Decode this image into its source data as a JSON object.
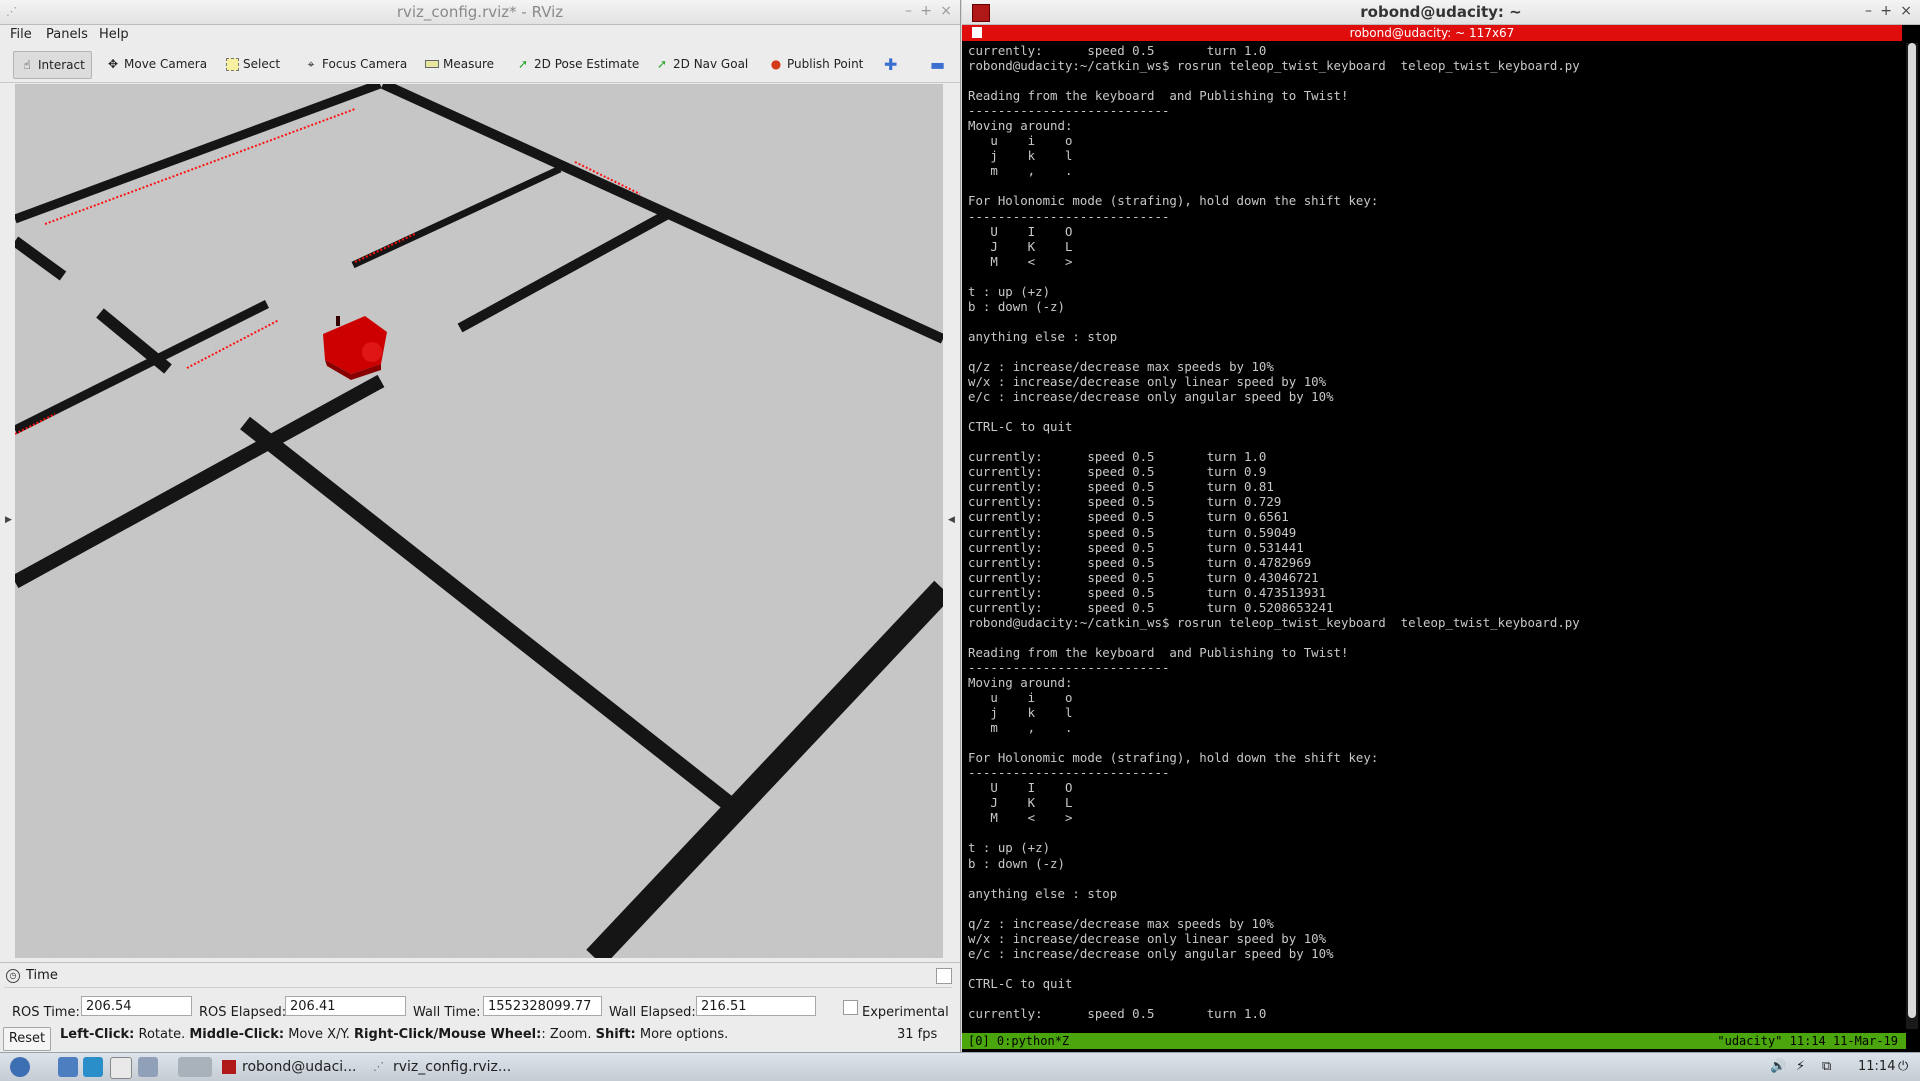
{
  "rviz": {
    "title": "rviz_config.rviz* - RViz",
    "window_buttons": [
      "–",
      "+",
      "×"
    ],
    "menu": [
      "File",
      "Panels",
      "Help"
    ],
    "tools": [
      {
        "label": "Interact",
        "icon": "hand-icon"
      },
      {
        "label": "Move Camera",
        "icon": "move-icon"
      },
      {
        "label": "Select",
        "icon": "select-icon"
      },
      {
        "label": "Focus Camera",
        "icon": "focus-icon"
      },
      {
        "label": "Measure",
        "icon": "ruler-icon"
      },
      {
        "label": "2D Pose Estimate",
        "icon": "pose-arrow-icon"
      },
      {
        "label": "2D Nav Goal",
        "icon": "goal-arrow-icon"
      },
      {
        "label": "Publish Point",
        "icon": "pin-icon"
      }
    ],
    "time_panel": {
      "title": "Time",
      "ros_time_label": "ROS Time:",
      "ros_time": "206.54",
      "ros_elapsed_label": "ROS Elapsed:",
      "ros_elapsed": "206.41",
      "wall_time_label": "Wall Time:",
      "wall_time": "1552328099.77",
      "wall_elapsed_label": "Wall Elapsed:",
      "wall_elapsed": "216.51",
      "experimental_label": "Experimental"
    },
    "status": {
      "reset": "Reset",
      "left_click": "Left-Click:",
      "left_click_desc": "Rotate.",
      "middle_click": "Middle-Click:",
      "middle_click_desc": "Move X/Y.",
      "right_click": "Right-Click/Mouse Wheel:",
      "right_click_desc": ": Zoom.",
      "shift": "Shift:",
      "shift_desc": "More options.",
      "fps": "31 fps"
    },
    "colors": {
      "floor": "#c6c6c6",
      "wall": "#151515",
      "robot": "#cc0000",
      "laser": "#ff1010"
    }
  },
  "terminal": {
    "title": "robond@udacity: ~",
    "tab_title": "robond@udacity: ~ 117x67",
    "lines": [
      "currently:      speed 0.5       turn 1.0",
      "robond@udacity:~/catkin_ws$ rosrun teleop_twist_keyboard  teleop_twist_keyboard.py",
      "",
      "Reading from the keyboard  and Publishing to Twist!",
      "---------------------------",
      "Moving around:",
      "   u    i    o",
      "   j    k    l",
      "   m    ,    .",
      "",
      "For Holonomic mode (strafing), hold down the shift key:",
      "---------------------------",
      "   U    I    O",
      "   J    K    L",
      "   M    <    >",
      "",
      "t : up (+z)",
      "b : down (-z)",
      "",
      "anything else : stop",
      "",
      "q/z : increase/decrease max speeds by 10%",
      "w/x : increase/decrease only linear speed by 10%",
      "e/c : increase/decrease only angular speed by 10%",
      "",
      "CTRL-C to quit",
      "",
      "currently:      speed 0.5       turn 1.0",
      "currently:      speed 0.5       turn 0.9",
      "currently:      speed 0.5       turn 0.81",
      "currently:      speed 0.5       turn 0.729",
      "currently:      speed 0.5       turn 0.6561",
      "currently:      speed 0.5       turn 0.59049",
      "currently:      speed 0.5       turn 0.531441",
      "currently:      speed 0.5       turn 0.4782969",
      "currently:      speed 0.5       turn 0.43046721",
      "currently:      speed 0.5       turn 0.473513931",
      "currently:      speed 0.5       turn 0.5208653241",
      "robond@udacity:~/catkin_ws$ rosrun teleop_twist_keyboard  teleop_twist_keyboard.py",
      "",
      "Reading from the keyboard  and Publishing to Twist!",
      "---------------------------",
      "Moving around:",
      "   u    i    o",
      "   j    k    l",
      "   m    ,    .",
      "",
      "For Holonomic mode (strafing), hold down the shift key:",
      "---------------------------",
      "   U    I    O",
      "   J    K    L",
      "   M    <    >",
      "",
      "t : up (+z)",
      "b : down (-z)",
      "",
      "anything else : stop",
      "",
      "q/z : increase/decrease max speeds by 10%",
      "w/x : increase/decrease only linear speed by 10%",
      "e/c : increase/decrease only angular speed by 10%",
      "",
      "CTRL-C to quit",
      "",
      "currently:      speed 0.5       turn 1.0"
    ],
    "status_left": "[0] 0:python*Z",
    "status_right": "\"udacity\" 11:14 11-Mar-19"
  },
  "taskbar": {
    "tasks": [
      {
        "label": "robond@udaci...",
        "icon": "terminal-icon"
      },
      {
        "label": "rviz_config.rviz...",
        "icon": "rviz-icon"
      }
    ],
    "clock": "11:14"
  }
}
